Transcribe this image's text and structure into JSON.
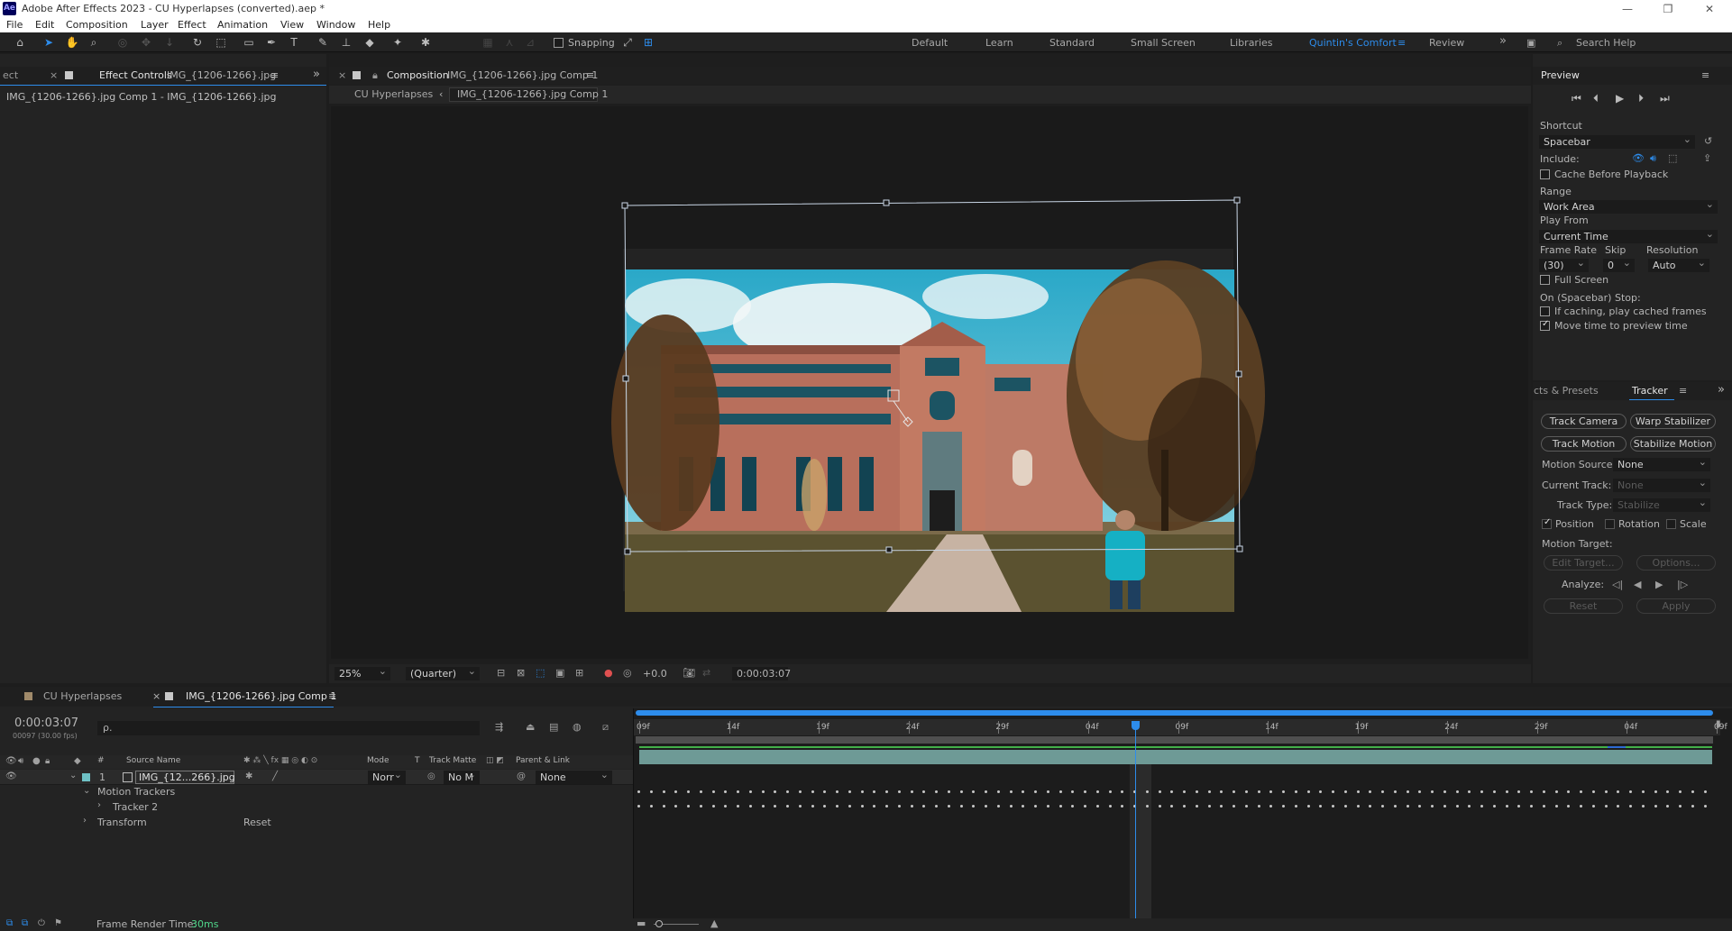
{
  "window": {
    "app_icon": "Ae",
    "title": "Adobe After Effects 2023 - CU Hyperlapses (converted).aep *",
    "controls": [
      "—",
      "❐",
      "✕"
    ]
  },
  "menu": [
    "File",
    "Edit",
    "Composition",
    "Layer",
    "Effect",
    "Animation",
    "View",
    "Window",
    "Help"
  ],
  "toolbar": {
    "snapping_label": "Snapping",
    "workspaces": [
      "Default",
      "Learn",
      "Standard",
      "Small Screen",
      "Libraries",
      "Quintin's Comfort",
      "Review"
    ],
    "active_workspace": "Quintin's Comfort",
    "search_placeholder": "Search Help"
  },
  "effect_controls": {
    "prev_tab_stub": "ect",
    "tab_prefix": "Effect Controls",
    "tab_file": "IMG_{1206-1266}.jpg",
    "layer_path": "IMG_{1206-1266}.jpg Comp 1 - IMG_{1206-1266}.jpg"
  },
  "composition": {
    "tab_prefix": "Composition",
    "tab_name": "IMG_{1206-1266}.jpg Comp 1",
    "breadcrumb_root": "CU Hyperlapses",
    "breadcrumb_current": "IMG_{1206-1266}.jpg Comp 1",
    "zoom": "25%",
    "resolution": "(Quarter)",
    "exposure": "+0.0",
    "timecode": "0:00:03:07"
  },
  "preview": {
    "title": "Preview",
    "shortcut_label": "Shortcut",
    "shortcut_value": "Spacebar",
    "include_label": "Include:",
    "cache_label": "Cache Before Playback",
    "range_label": "Range",
    "range_value": "Work Area",
    "play_from_label": "Play From",
    "play_from_value": "Current Time",
    "frame_rate_label": "Frame Rate",
    "skip_label": "Skip",
    "resolution_label": "Resolution",
    "frame_rate_value": "(30)",
    "skip_value": "0",
    "resolution_value": "Auto",
    "full_screen_label": "Full Screen",
    "stop_label": "On (Spacebar) Stop:",
    "if_caching_label": "If caching, play cached frames",
    "move_time_label": "Move time to preview time"
  },
  "tracker": {
    "effects_tab": "cts & Presets",
    "tracker_tab": "Tracker",
    "track_camera": "Track Camera",
    "warp_stabilizer": "Warp Stabilizer",
    "track_motion": "Track Motion",
    "stabilize_motion": "Stabilize Motion",
    "motion_source_label": "Motion Source:",
    "motion_source_value": "None",
    "current_track_label": "Current Track:",
    "current_track_value": "None",
    "track_type_label": "Track Type:",
    "track_type_value": "Stabilize",
    "position_label": "Position",
    "rotation_label": "Rotation",
    "scale_label": "Scale",
    "motion_target_label": "Motion Target:",
    "edit_target": "Edit Target...",
    "options": "Options...",
    "analyze_label": "Analyze:",
    "reset": "Reset",
    "apply": "Apply"
  },
  "timeline": {
    "tab1": "CU Hyperlapses",
    "tab2": "IMG_{1206-1266}.jpg Comp 1",
    "current_time": "0:00:03:07",
    "frame_info": "00097 (30.00 fps)",
    "search_placeholder": "ρ.",
    "columns": {
      "num": "#",
      "source": "Source Name",
      "mode": "Mode",
      "t": "T",
      "track_matte": "Track Matte",
      "parent": "Parent & Link"
    },
    "layer": {
      "index": "1",
      "name": "IMG_{12...266}.jpg",
      "mode": "Norr",
      "matte": "No M",
      "parent": "None"
    },
    "sub_rows": {
      "motion_trackers": "Motion Trackers",
      "tracker2": "Tracker 2",
      "transform": "Transform",
      "reset": "Reset"
    },
    "ruler_labels": [
      "09f",
      "14f",
      "19f",
      "24f",
      "29f",
      "04f",
      "09f",
      "14f",
      "19f",
      "24f",
      "29f",
      "04f",
      "09f"
    ],
    "playhead_position": 0.46,
    "render_time_label": "Frame Render Time:",
    "render_time_value": "30ms"
  }
}
